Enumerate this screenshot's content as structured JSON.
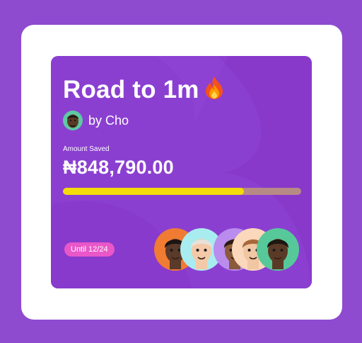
{
  "card": {
    "title": "Road to 1m",
    "title_emoji": "fire-icon",
    "byline": "by Cho",
    "amount_label": "Amount Saved",
    "amount": "₦848,790.00",
    "progress": 0.76,
    "until": "Until 12/24"
  },
  "members": [
    {
      "name": "member-avatar-1",
      "bg": "#f07b32",
      "skin": "#5a3a2a",
      "hair": "#1b1512"
    },
    {
      "name": "member-avatar-2",
      "bg": "#a8ecef",
      "skin": "#f3c9a8",
      "hair": "#e9e0d8"
    },
    {
      "name": "member-avatar-3",
      "bg": "#b98cee",
      "skin": "#8a5a3c",
      "hair": "#2a1a10"
    },
    {
      "name": "member-avatar-4",
      "bg": "#fbd8bb",
      "skin": "#f1c6a2",
      "hair": "#a8683a"
    },
    {
      "name": "member-avatar-5",
      "bg": "#57c89a",
      "skin": "#5a3a26",
      "hair": "#1e1712"
    }
  ],
  "colors": {
    "page_bg": "#8e4bd0",
    "card_bg": "#8b3fd1",
    "progress_fill": "#f4dc0a",
    "progress_track": "#b88a86",
    "pill_bg": "#e957c8"
  }
}
